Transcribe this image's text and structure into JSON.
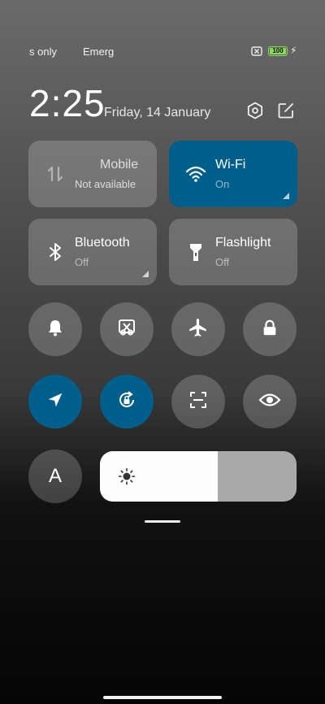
{
  "status_bar": {
    "carrier_1": "s only",
    "carrier_2": "Emerg",
    "battery_level": "100",
    "battery_fraction": 1.0,
    "battery_color": "#8bd95a",
    "icons": [
      "sim-no-signal-icon",
      "battery-icon",
      "charging-bolt-icon"
    ]
  },
  "header": {
    "time": "2:25",
    "date": "Friday, 14 January",
    "icons": [
      "settings-icon",
      "edit-icon"
    ]
  },
  "tiles": [
    {
      "title": "Mobile",
      "subtitle": "Not available",
      "icon": "mobile-data-icon",
      "state": "unavailable"
    },
    {
      "title": "Wi-Fi",
      "subtitle": "On",
      "icon": "wifi-icon",
      "state": "on"
    },
    {
      "title": "Bluetooth",
      "subtitle": "Off",
      "icon": "bluetooth-icon",
      "state": "off"
    },
    {
      "title": "Flashlight",
      "subtitle": "Off",
      "icon": "flashlight-icon",
      "state": "off"
    }
  ],
  "toggles_row1": [
    {
      "icon": "bell-icon",
      "state": "off"
    },
    {
      "icon": "screenshot-scissors-icon",
      "state": "off"
    },
    {
      "icon": "airplane-icon",
      "state": "off"
    },
    {
      "icon": "lock-icon",
      "state": "off"
    }
  ],
  "toggles_row2": [
    {
      "icon": "location-icon",
      "state": "on"
    },
    {
      "icon": "rotation-lock-icon",
      "state": "on"
    },
    {
      "icon": "scan-icon",
      "state": "off"
    },
    {
      "icon": "eye-icon",
      "state": "off"
    }
  ],
  "auto_brightness": {
    "label": "A"
  },
  "brightness": {
    "level": 0.6,
    "icon": "sun-icon"
  },
  "colors": {
    "accent": "#005f8a",
    "tile_bg": "rgba(255,255,255,0.2)"
  }
}
